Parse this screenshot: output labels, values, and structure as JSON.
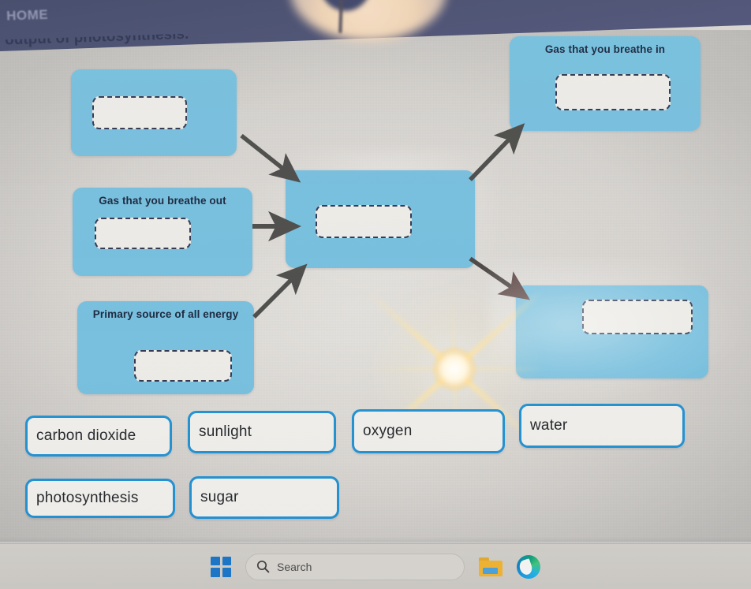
{
  "window": {
    "app_banner_text": "HOME",
    "instruction_text": "output of photosynthesis."
  },
  "diagram": {
    "boxes": [
      {
        "id": "top-left",
        "label": "",
        "dropzone_value": ""
      },
      {
        "id": "breathe-out",
        "label": "Gas that you breathe out",
        "dropzone_value": ""
      },
      {
        "id": "energy",
        "label": "Primary source of all energy",
        "dropzone_value": ""
      },
      {
        "id": "center",
        "label": "",
        "dropzone_value": ""
      },
      {
        "id": "breathe-in",
        "label": "Gas that you breathe in",
        "dropzone_value": ""
      },
      {
        "id": "lower-right",
        "label": "",
        "dropzone_value": ""
      }
    ],
    "arrows": [
      {
        "from": "top-left",
        "to": "center",
        "direction": "down-right"
      },
      {
        "from": "breathe-out",
        "to": "center",
        "direction": "right"
      },
      {
        "from": "energy",
        "to": "center",
        "direction": "up-right"
      },
      {
        "from": "center",
        "to": "breathe-in",
        "direction": "up-right"
      },
      {
        "from": "center",
        "to": "lower-right",
        "direction": "down-right"
      }
    ],
    "colors": {
      "box_fill": "#74bedd",
      "dropzone_fill": "#ecebe6",
      "dropzone_border": "#2d3550",
      "arrow": "#4a4a48",
      "label_text": "#17243c"
    }
  },
  "word_bank": {
    "options": [
      "carbon dioxide",
      "sunlight",
      "oxygen",
      "water",
      "photosynthesis",
      "sugar"
    ],
    "chip_border_color": "#1f8fd0",
    "chip_fill_color": "#eeede9"
  },
  "taskbar": {
    "start_icon": "windows-start-icon",
    "search_placeholder": "Search",
    "search_icon": "search-icon",
    "apps": [
      {
        "name": "file-explorer",
        "icon": "folder-icon"
      },
      {
        "name": "microsoft-edge",
        "icon": "edge-icon"
      }
    ]
  }
}
